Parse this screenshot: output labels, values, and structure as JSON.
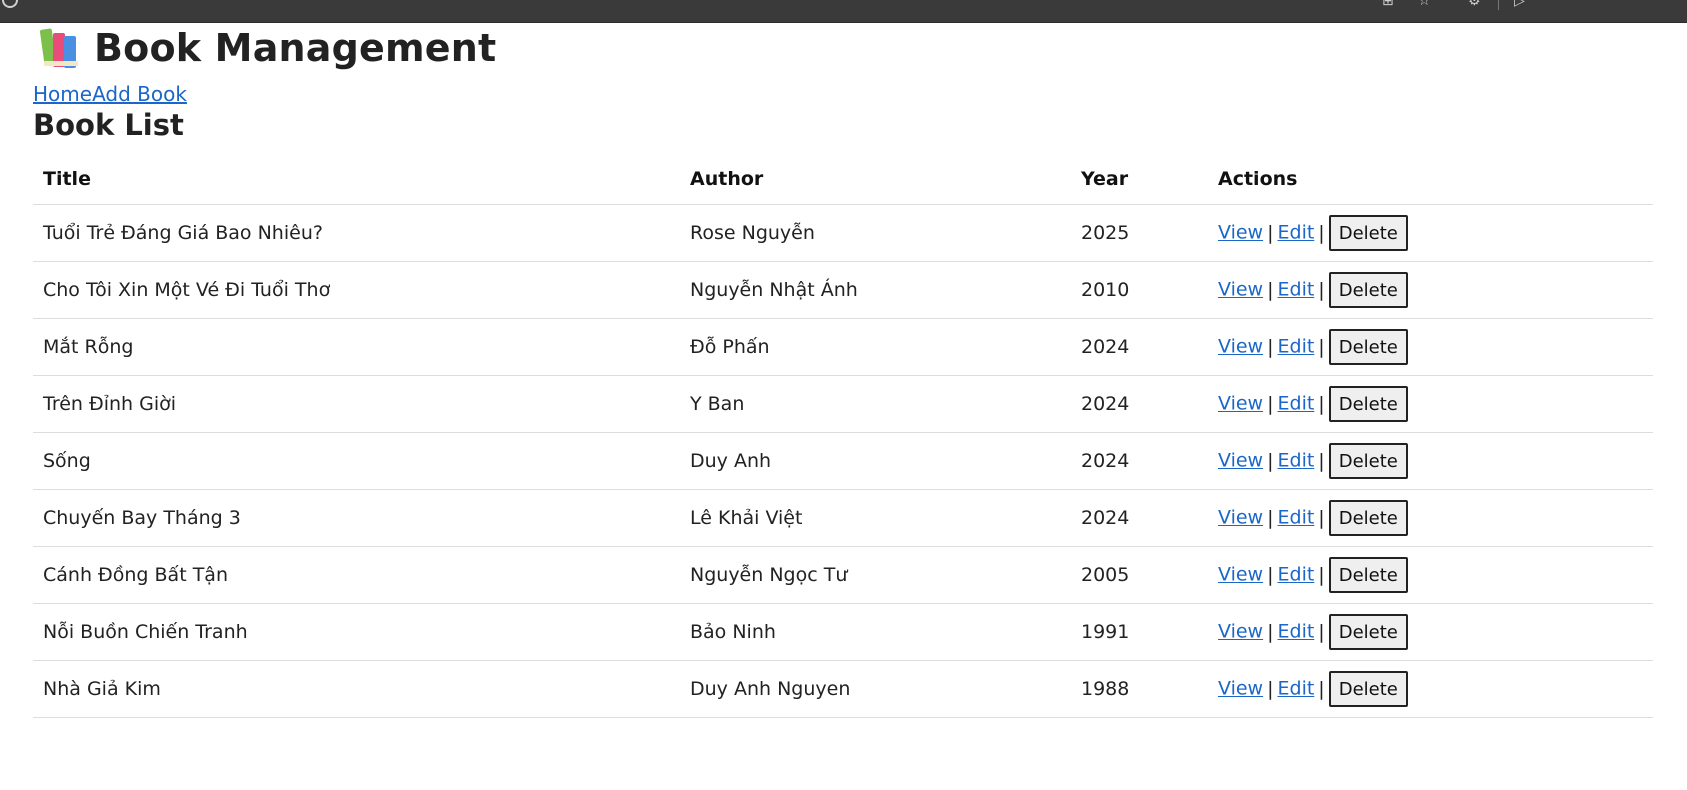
{
  "app": {
    "title": "Book Management",
    "icon": "books-icon"
  },
  "nav": {
    "home_label": "Home",
    "add_book_label": "Add Book"
  },
  "section_title": "Book List",
  "table": {
    "headers": {
      "title": "Title",
      "author": "Author",
      "year": "Year",
      "actions": "Actions"
    },
    "action_labels": {
      "view": "View",
      "edit": "Edit",
      "delete": "Delete",
      "separator": "|"
    },
    "rows": [
      {
        "title": "Tuổi Trẻ Đáng Giá Bao Nhiêu?",
        "author": "Rose Nguyễn",
        "year": "2025"
      },
      {
        "title": "Cho Tôi Xin Một Vé Đi Tuổi Thơ",
        "author": "Nguyễn Nhật Ánh",
        "year": "2010"
      },
      {
        "title": "Mắt Rỗng",
        "author": "Đỗ Phấn",
        "year": "2024"
      },
      {
        "title": "Trên Đỉnh Giời",
        "author": "Y Ban",
        "year": "2024"
      },
      {
        "title": "Sống",
        "author": "Duy Anh",
        "year": "2024"
      },
      {
        "title": "Chuyến Bay Tháng 3",
        "author": "Lê Khải Việt",
        "year": "2024"
      },
      {
        "title": "Cánh Đồng Bất Tận",
        "author": "Nguyễn Ngọc Tư",
        "year": "2005"
      },
      {
        "title": "Nỗi Buồn Chiến Tranh",
        "author": "Bảo Ninh",
        "year": "1991"
      },
      {
        "title": "Nhà Giả Kim",
        "author": "Duy Anh Nguyen",
        "year": "1988"
      }
    ]
  },
  "colors": {
    "link": "#1a66c9",
    "text": "#222222",
    "row_border": "#dddddd",
    "button_bg": "#efefef"
  }
}
